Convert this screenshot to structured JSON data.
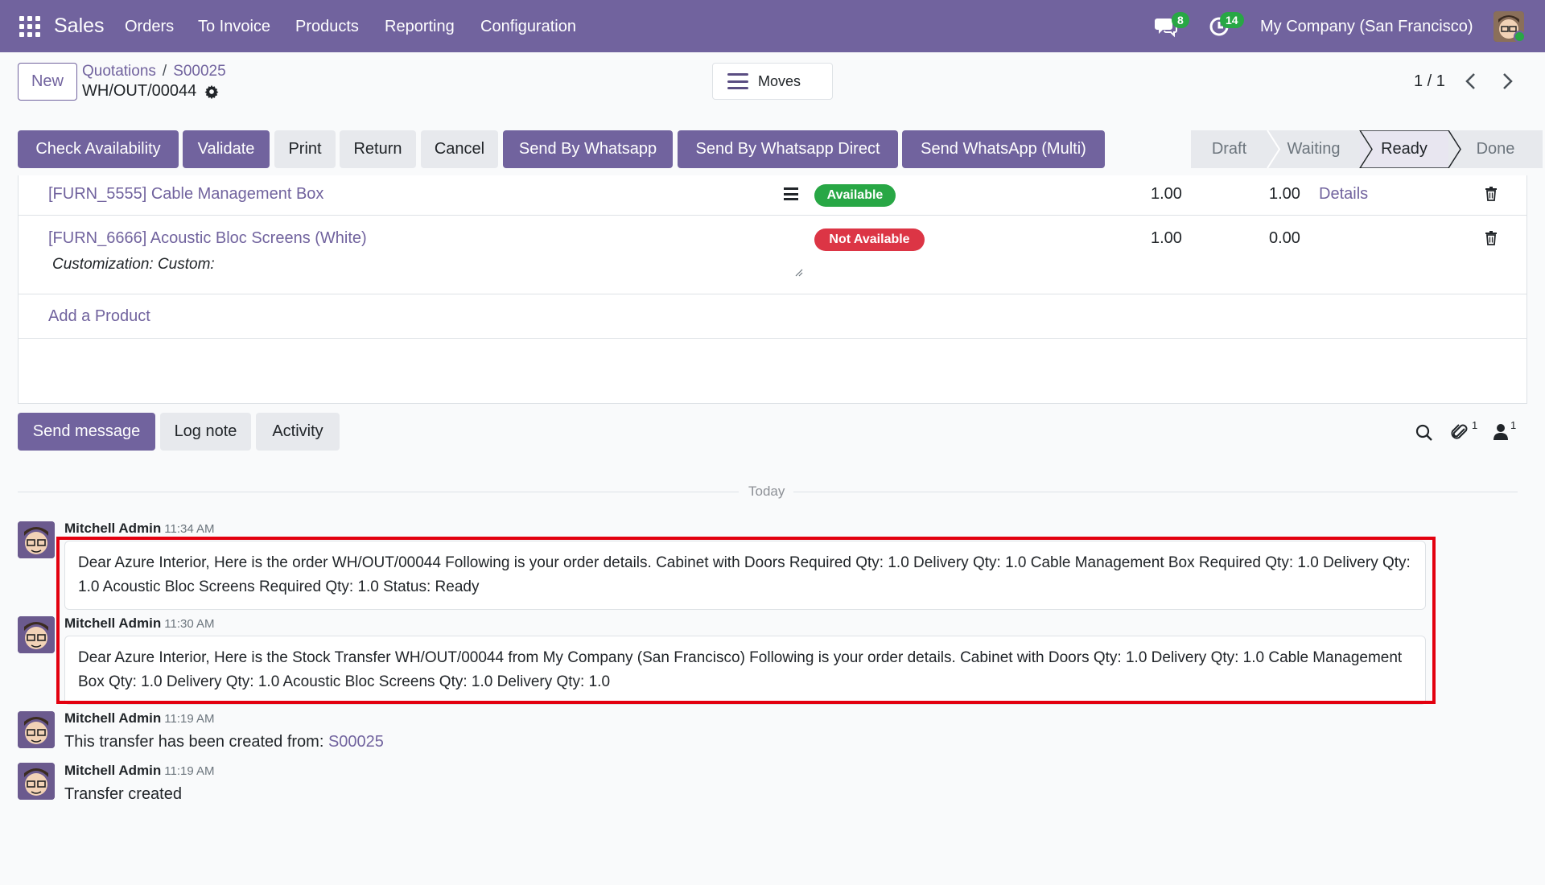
{
  "navbar": {
    "app_name": "Sales",
    "menu": [
      "Orders",
      "To Invoice",
      "Products",
      "Reporting",
      "Configuration"
    ],
    "messages_count": "8",
    "activities_count": "14",
    "company": "My Company (San Francisco)"
  },
  "control": {
    "new_label": "New",
    "breadcrumb": [
      "Quotations",
      "S00025"
    ],
    "record_name": "WH/OUT/00044",
    "moves_label": "Moves",
    "pager": "1 / 1"
  },
  "actions": [
    "Check Availability",
    "Validate",
    "Print",
    "Return",
    "Cancel",
    "Send By Whatsapp",
    "Send By Whatsapp Direct",
    "Send WhatsApp (Multi)"
  ],
  "statusbar": {
    "stages": [
      "Draft",
      "Waiting",
      "Ready",
      "Done"
    ],
    "active": "Ready"
  },
  "lines": [
    {
      "product": "[FURN_5555] Cable Management Box",
      "availability": "Available",
      "demand": "1.00",
      "quantity": "1.00",
      "details": "Details"
    },
    {
      "product": "[FURN_6666] Acoustic Bloc Screens (White)",
      "description": "Customization: Custom:",
      "availability": "Not Available",
      "demand": "1.00",
      "quantity": "0.00"
    }
  ],
  "add_product": "Add a Product",
  "chatter": {
    "send_message": "Send message",
    "log_note": "Log note",
    "activity": "Activity",
    "attachments_count": "1",
    "followers_count": "1",
    "date_separator": "Today",
    "messages": [
      {
        "author": "Mitchell Admin",
        "time": "11:34 AM",
        "body": "Dear Azure Interior, Here is the order WH/OUT/00044 Following is your order details. Cabinet with Doors Required Qty: 1.0 Delivery Qty: 1.0 Cable Management Box Required Qty: 1.0 Delivery Qty: 1.0 Acoustic Bloc Screens Required Qty: 1.0 Status: Ready"
      },
      {
        "author": "Mitchell Admin",
        "time": "11:30 AM",
        "body": "Dear Azure Interior, Here is the Stock Transfer WH/OUT/00044 from My Company (San Francisco) Following is your order details. Cabinet with Doors Qty: 1.0 Delivery Qty: 1.0 Cable Management Box Qty: 1.0 Delivery Qty: 1.0 Acoustic Bloc Screens Qty: 1.0 Delivery Qty: 1.0"
      },
      {
        "author": "Mitchell Admin",
        "time": "11:19 AM",
        "body_prefix": "This transfer has been created from:",
        "link": "S00025"
      },
      {
        "author": "Mitchell Admin",
        "time": "11:19 AM",
        "body": "Transfer created"
      }
    ]
  },
  "colors": {
    "brand": "#71639e",
    "highlight": "#e3000f",
    "available": "#28a745",
    "not_available": "#dc3545"
  }
}
